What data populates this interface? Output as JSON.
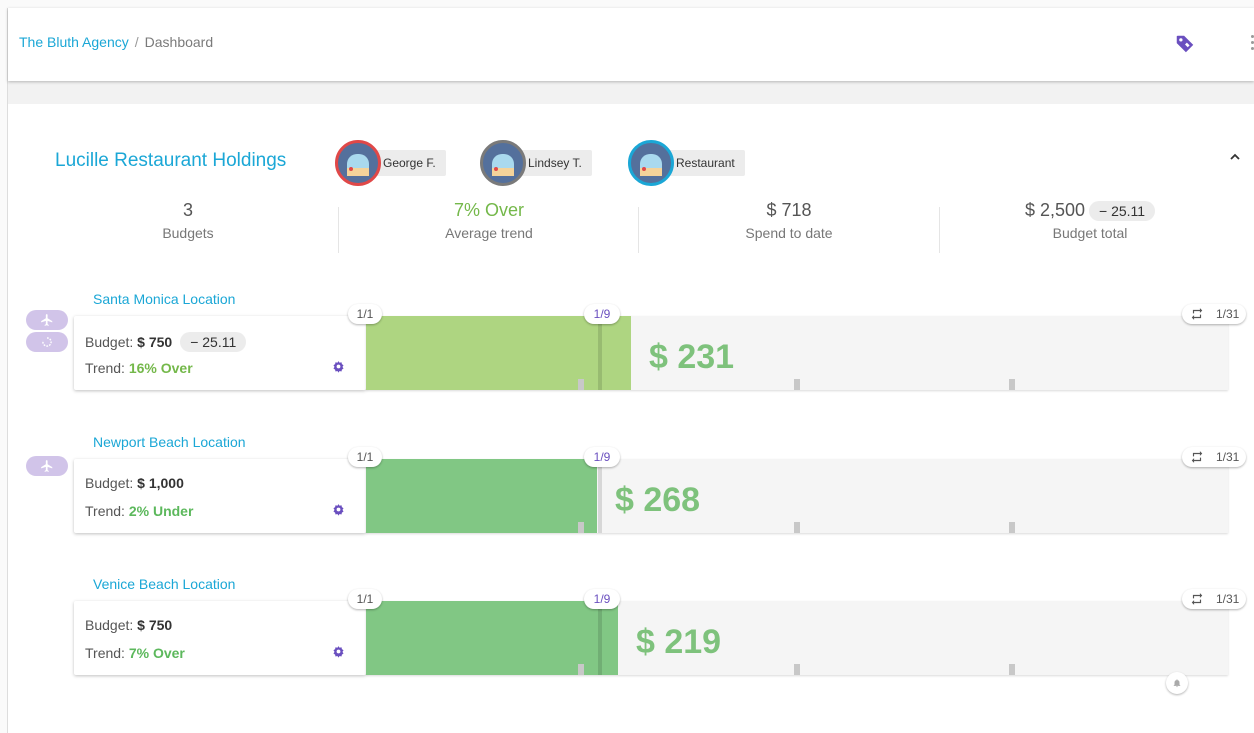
{
  "breadcrumb": {
    "agency": "The Bluth Agency",
    "separator": "/",
    "page": "Dashboard"
  },
  "client": {
    "name": "Lucille Restaurant Holdings",
    "chips": [
      {
        "label": "George F.",
        "border": "#e04848"
      },
      {
        "label": "Lindsey T.",
        "border": "#7a7a7a"
      },
      {
        "label": "Restaurant",
        "border": "#1ba7d6"
      }
    ]
  },
  "stats": [
    {
      "value": "3",
      "label": "Budgets"
    },
    {
      "value": "7% Over",
      "label": "Average trend"
    },
    {
      "value": "$ 718",
      "label": "Spend to date"
    },
    {
      "value": "$ 2,500",
      "delta": "− 25.11",
      "label": "Budget total"
    }
  ],
  "locations": [
    {
      "title": "Santa Monica Location",
      "budget_label": "Budget:",
      "budget": "$ 750",
      "delta": "− 25.11",
      "trend_label": "Trend:",
      "trend": "16% Over",
      "amount": "$ 231",
      "start": "1/1",
      "today": "1/9",
      "end": "1/31",
      "spent_fraction": 0.308,
      "fill_color": "#aed581",
      "icons": [
        "airplane-icon",
        "refresh-icon"
      ]
    },
    {
      "title": "Newport Beach Location",
      "budget_label": "Budget:",
      "budget": "$ 1,000",
      "delta": "",
      "trend_label": "Trend:",
      "trend": "2% Under",
      "amount": "$ 268",
      "start": "1/1",
      "today": "1/9",
      "end": "1/31",
      "spent_fraction": 0.268,
      "fill_color": "#81c784",
      "icons": [
        "airplane-icon"
      ]
    },
    {
      "title": "Venice Beach Location",
      "budget_label": "Budget:",
      "budget": "$ 750",
      "delta": "",
      "trend_label": "Trend:",
      "trend": "7% Over",
      "amount": "$ 219",
      "start": "1/1",
      "today": "1/9",
      "end": "1/31",
      "spent_fraction": 0.292,
      "fill_color": "#81c784",
      "icons": []
    }
  ],
  "colors": {
    "accent": "#1ba7d6",
    "purple": "#6a4fbf",
    "green": "#74b84a"
  }
}
